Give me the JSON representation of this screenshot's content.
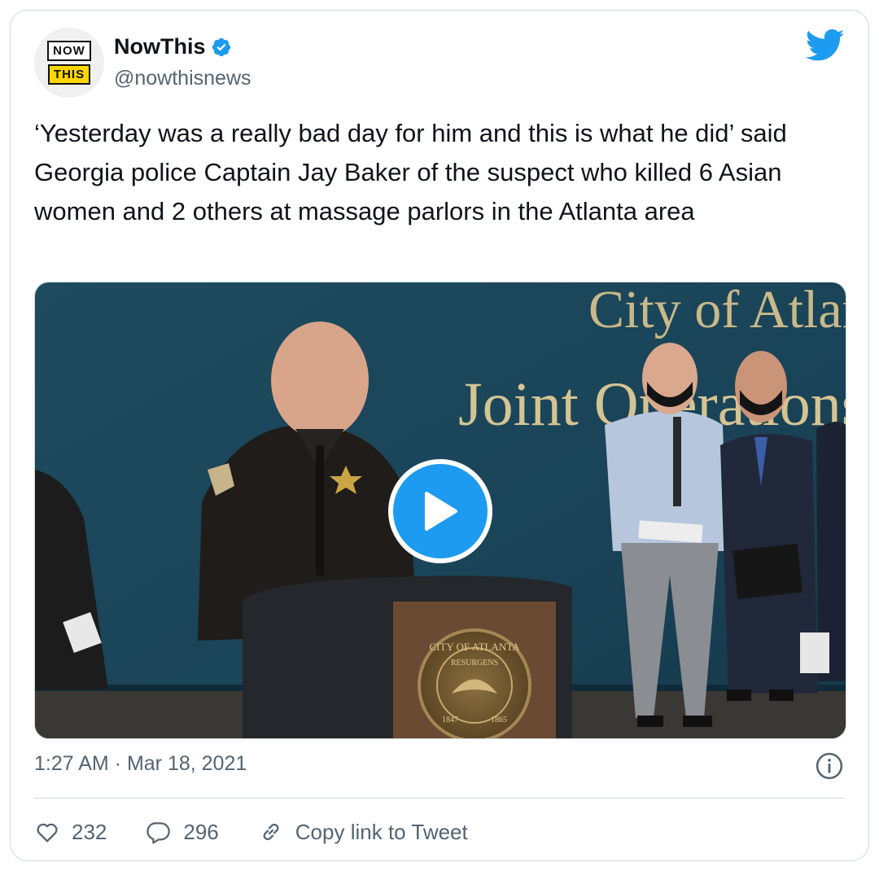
{
  "author": {
    "name": "NowThis",
    "handle": "@nowthisnews",
    "logo_top": "NOW",
    "logo_bottom": "THIS"
  },
  "tweet": {
    "text": "‘Yesterday was a really bad day for him and this is what he did’ said Georgia police Captain Jay Baker of the suspect who killed 6 Asian women and 2 others at massage parlors in the Atlanta area",
    "timestamp": "1:27 AM · Mar 18, 2021"
  },
  "media": {
    "wall_sign_line1": "City of Atlan",
    "wall_sign_line2": "Joint Operations C",
    "seal_text": "CITY OF ATLANTA",
    "seal_motto": "RESURGENS",
    "seal_year_left": "1847",
    "seal_year_right": "1865"
  },
  "actions": {
    "likes": "232",
    "replies": "296",
    "copy_link": "Copy link to Tweet"
  },
  "colors": {
    "accent": "#1d9bf0",
    "secondary_text": "#536471",
    "border": "#cfd9de"
  },
  "icons": [
    "nowthis-logo",
    "verified-badge-icon",
    "twitter-bird-icon",
    "play-icon",
    "info-icon",
    "heart-icon",
    "reply-icon",
    "link-icon"
  ]
}
